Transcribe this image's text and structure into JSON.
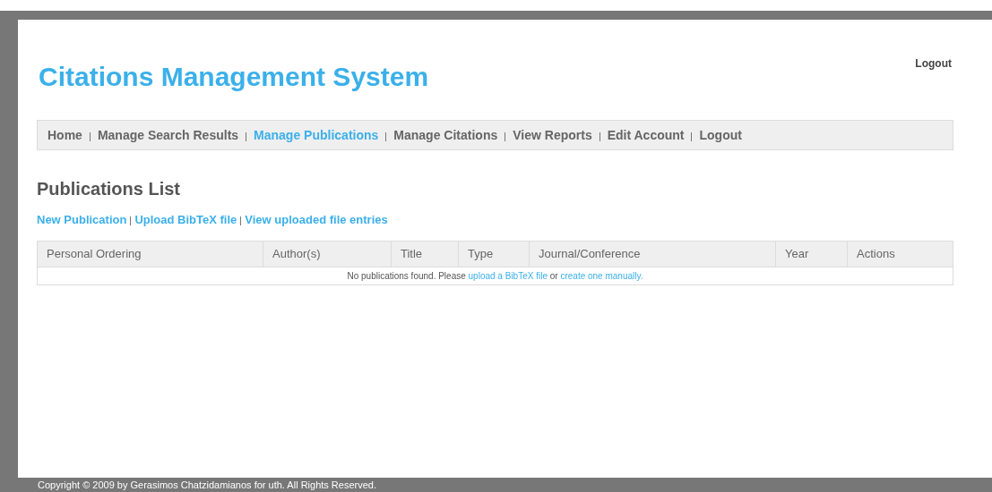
{
  "header": {
    "title": "Citations Management System",
    "logout": "Logout"
  },
  "nav": [
    {
      "label": "Home",
      "selected": false
    },
    {
      "label": "Manage Search Results",
      "selected": false
    },
    {
      "label": "Manage Publications",
      "selected": true
    },
    {
      "label": "Manage Citations",
      "selected": false
    },
    {
      "label": "View Reports",
      "selected": false
    },
    {
      "label": "Edit Account",
      "selected": false
    },
    {
      "label": "Logout",
      "selected": false
    }
  ],
  "page_title": "Publications List",
  "actions": [
    "New Publication",
    "Upload BibTeX file",
    "View uploaded file entries"
  ],
  "table": {
    "columns": [
      "Personal Ordering",
      "Author(s)",
      "Title",
      "Type",
      "Journal/Conference",
      "Year",
      "Actions"
    ],
    "empty_message": [
      {
        "kind": "text",
        "text": "No publications found. Please "
      },
      {
        "kind": "link",
        "text": "upload a BibTeX file"
      },
      {
        "kind": "text",
        "text": " or "
      },
      {
        "kind": "link",
        "text": "create one manually."
      }
    ]
  },
  "footer": "Copyright © 2009 by Gerasimos Chatzidamianos for uth. All Rights Reserved."
}
